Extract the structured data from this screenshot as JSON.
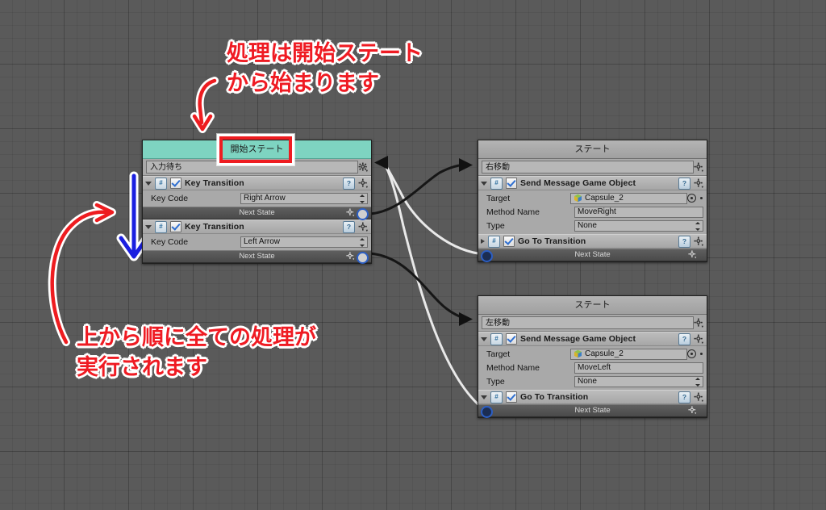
{
  "canvas": {
    "background_color": "#5a5a5a",
    "grid": true
  },
  "annotations": [
    {
      "id": "top-note",
      "text": "処理は開始ステート\nから始まります",
      "color": "#ef1b23"
    },
    {
      "id": "bottom-note",
      "text": "上から順に全ての処理が\n実行されます",
      "color": "#ef1b23"
    }
  ],
  "highlight": {
    "color": "#ee1c20",
    "target": "開始ステート"
  },
  "arrows": {
    "red_top": {
      "color": "#ee1c20",
      "direction": "down"
    },
    "red_bottom": {
      "color": "#ee1c20",
      "direction": "right"
    },
    "blue": {
      "color": "#1a1fe0",
      "direction": "down"
    }
  },
  "nodes": {
    "start_state": {
      "title": "開始ステート",
      "title_color": "#7ed4c1",
      "name_value": "入力待ち",
      "gear_icon": "gear-icon",
      "components": [
        {
          "title": "Key Transition",
          "cs_icon": "csharp-script-icon",
          "help_icon": "help-icon",
          "gear_icon": "gear-icon",
          "enabled": true,
          "expanded": true,
          "properties": [
            {
              "label": "Key Code",
              "value": "Right Arrow",
              "control": "dropdown"
            }
          ],
          "next_state_label": "Next State"
        },
        {
          "title": "Key Transition",
          "cs_icon": "csharp-script-icon",
          "help_icon": "help-icon",
          "gear_icon": "gear-icon",
          "enabled": true,
          "expanded": true,
          "properties": [
            {
              "label": "Key Code",
              "value": "Left Arrow",
              "control": "dropdown"
            }
          ],
          "next_state_label": "Next State"
        }
      ]
    },
    "right_state": {
      "title": "ステート",
      "name_value": "右移動",
      "gear_icon": "gear-icon",
      "components": [
        {
          "title": "Send Message Game Object",
          "cs_icon": "csharp-script-icon",
          "help_icon": "help-icon",
          "gear_icon": "gear-icon",
          "enabled": true,
          "expanded": true,
          "properties": [
            {
              "label": "Target",
              "value": "Capsule_2",
              "control": "object-field",
              "icon": "capsule-object-icon"
            },
            {
              "label": "Method Name",
              "value": "MoveRight",
              "control": "text-field"
            },
            {
              "label": "Type",
              "value": "None",
              "control": "dropdown"
            }
          ]
        },
        {
          "title": "Go To Transition",
          "cs_icon": "csharp-script-icon",
          "help_icon": "help-icon",
          "gear_icon": "gear-icon",
          "enabled": true,
          "expanded": false,
          "properties": [],
          "next_state_label": "Next State"
        }
      ]
    },
    "left_state": {
      "title": "ステート",
      "name_value": "左移動",
      "gear_icon": "gear-icon",
      "components": [
        {
          "title": "Send Message Game Object",
          "cs_icon": "csharp-script-icon",
          "help_icon": "help-icon",
          "gear_icon": "gear-icon",
          "enabled": true,
          "expanded": true,
          "properties": [
            {
              "label": "Target",
              "value": "Capsule_2",
              "control": "object-field",
              "icon": "capsule-object-icon"
            },
            {
              "label": "Method Name",
              "value": "MoveLeft",
              "control": "text-field"
            },
            {
              "label": "Type",
              "value": "None",
              "control": "dropdown"
            }
          ]
        },
        {
          "title": "Go To Transition",
          "cs_icon": "csharp-script-icon",
          "help_icon": "help-icon",
          "gear_icon": "gear-icon",
          "enabled": true,
          "expanded": true,
          "properties": [],
          "next_state_label": "Next State"
        }
      ]
    }
  }
}
